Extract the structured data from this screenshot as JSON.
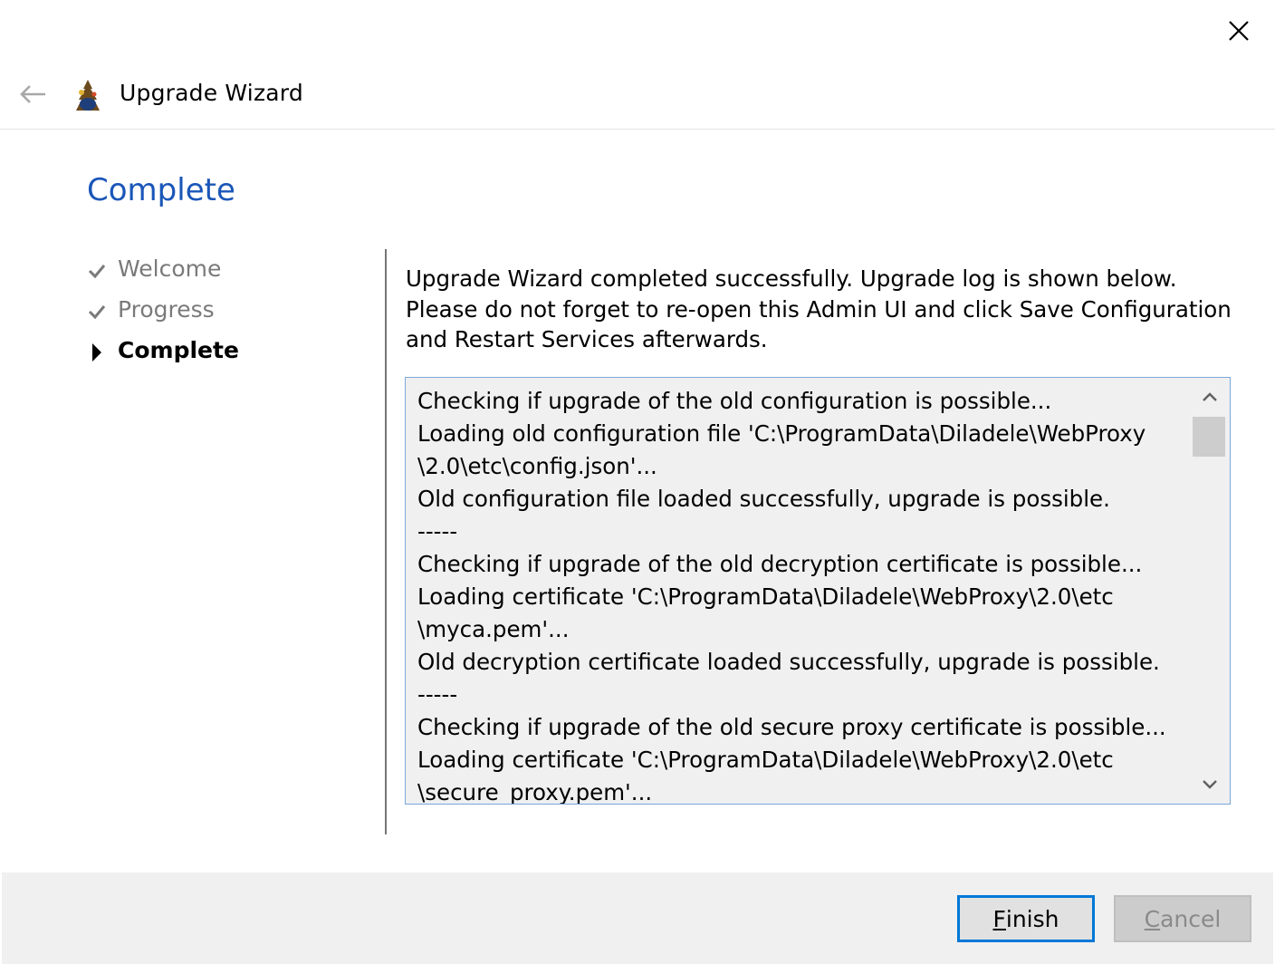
{
  "window": {
    "title": "Upgrade Wizard",
    "close_icon": "close-icon",
    "back_icon": "back-arrow-icon"
  },
  "page": {
    "title": "Complete"
  },
  "steps": [
    {
      "label": "Welcome",
      "state": "done",
      "icon": "checkmark-icon"
    },
    {
      "label": "Progress",
      "state": "done",
      "icon": "checkmark-icon"
    },
    {
      "label": "Complete",
      "state": "current",
      "icon": "play-arrow-icon"
    }
  ],
  "description": {
    "line1": "Upgrade Wizard completed successfully. Upgrade log is shown below.",
    "line2": "Please do not forget to re-open this Admin UI and click Save Configuration",
    "line3": "and Restart Services afterwards."
  },
  "log": {
    "lines": [
      "Checking if upgrade of the old configuration is possible...",
      "Loading old configuration file 'C:\\ProgramData\\Diladele\\WebProxy",
      "\\2.0\\etc\\config.json'...",
      "Old configuration file loaded successfully, upgrade is possible.",
      "-----",
      "Checking if upgrade of the old decryption certificate is possible...",
      "Loading certificate 'C:\\ProgramData\\Diladele\\WebProxy\\2.0\\etc",
      "\\myca.pem'...",
      "Old decryption certificate loaded successfully, upgrade is possible.",
      "-----",
      "Checking if upgrade of the old secure proxy certificate is possible...",
      "Loading certificate 'C:\\ProgramData\\Diladele\\WebProxy\\2.0\\etc",
      "\\secure_proxy.pem'..."
    ]
  },
  "buttons": {
    "finish": {
      "accel": "F",
      "rest": "inish",
      "enabled": true
    },
    "cancel": {
      "accel": "C",
      "rest": "ancel",
      "enabled": false
    }
  },
  "colors": {
    "accent": "#0078d7",
    "title_blue": "#1a56b8",
    "log_border": "#7aa7dc",
    "footer_bg": "#f0f0f0"
  }
}
